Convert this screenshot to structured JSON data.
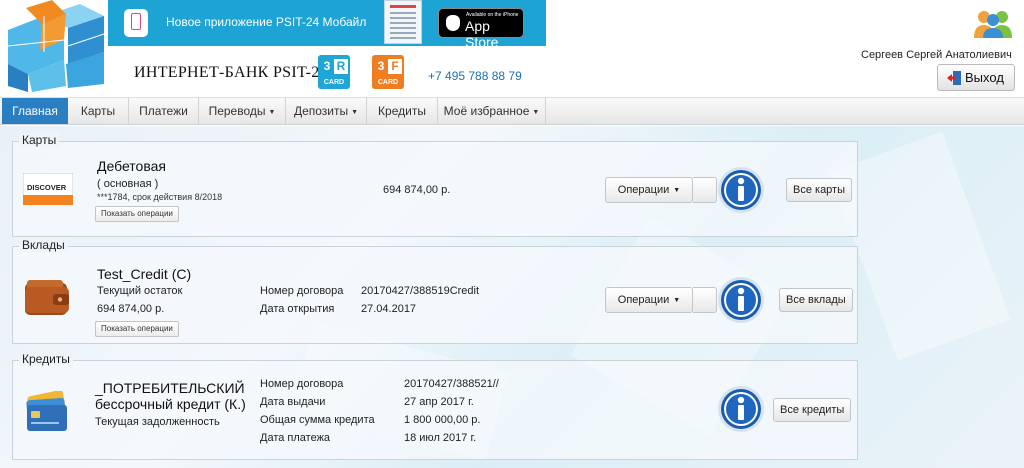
{
  "header": {
    "promo_text": "Новое приложение PSIT-24 Мобайл",
    "appstore_small": "Available on the iPhone",
    "appstore_big": "App Store",
    "bank_name": "ИНТЕРНЕТ-БАНК  PSIT-24",
    "card_3r": {
      "letters": [
        "3",
        "R"
      ],
      "word": "CARD"
    },
    "card_3f": {
      "letters": [
        "3",
        "F"
      ],
      "word": "CARD"
    },
    "phone": "+7 495 788 88 79",
    "user_name": "Сергеев Сергей Анатолиевич",
    "logout_label": "Выход"
  },
  "nav": {
    "items": [
      {
        "label": "Главная",
        "active": true
      },
      {
        "label": "Карты"
      },
      {
        "label": "Платежи"
      },
      {
        "label": "Переводы",
        "dropdown": true
      },
      {
        "label": "Депозиты",
        "dropdown": true
      },
      {
        "label": "Кредиты"
      },
      {
        "label": "Моё избранное",
        "dropdown": true
      }
    ]
  },
  "cards": {
    "legend": "Карты",
    "brand": "DISCOVER",
    "title": "Дебетовая",
    "subtitle": "( основная )",
    "details": "***1784, срок действия 8/2018",
    "show_ops": "Показать операции",
    "amount": "694 874,00 р.",
    "operations": "Операции",
    "all": "Все карты"
  },
  "deposits": {
    "legend": "Вклады",
    "title": "Test_Credit (C)",
    "balance_label": "Текущий остаток",
    "balance": "694 874,00 р.",
    "show_ops": "Показать операции",
    "contract_label": "Номер договора",
    "contract_value": "20170427/388519Credit",
    "open_label": "Дата открытия",
    "open_value": "27.04.2017",
    "operations": "Операции",
    "all": "Все вклады"
  },
  "credits": {
    "legend": "Кредиты",
    "title1": "_ПОТРЕБИТЕЛЬСКИЙ",
    "title2": "бессрочный кредит (К.)",
    "debt_label": "Текущая задолженность",
    "contract_label": "Номер договора",
    "contract_value": "20170427/388521//",
    "issue_label": "Дата выдачи",
    "issue_value": "27 апр 2017 г.",
    "total_label": "Общая сумма кредита",
    "total_value": "1 800 000,00 р.",
    "pay_label": "Дата платежа",
    "pay_value": "18 июл 2017 г.",
    "all": "Все кредиты"
  },
  "colors": {
    "accent": "#2a7ec2",
    "promo": "#1da3d4",
    "info": "#1a5cb0"
  }
}
